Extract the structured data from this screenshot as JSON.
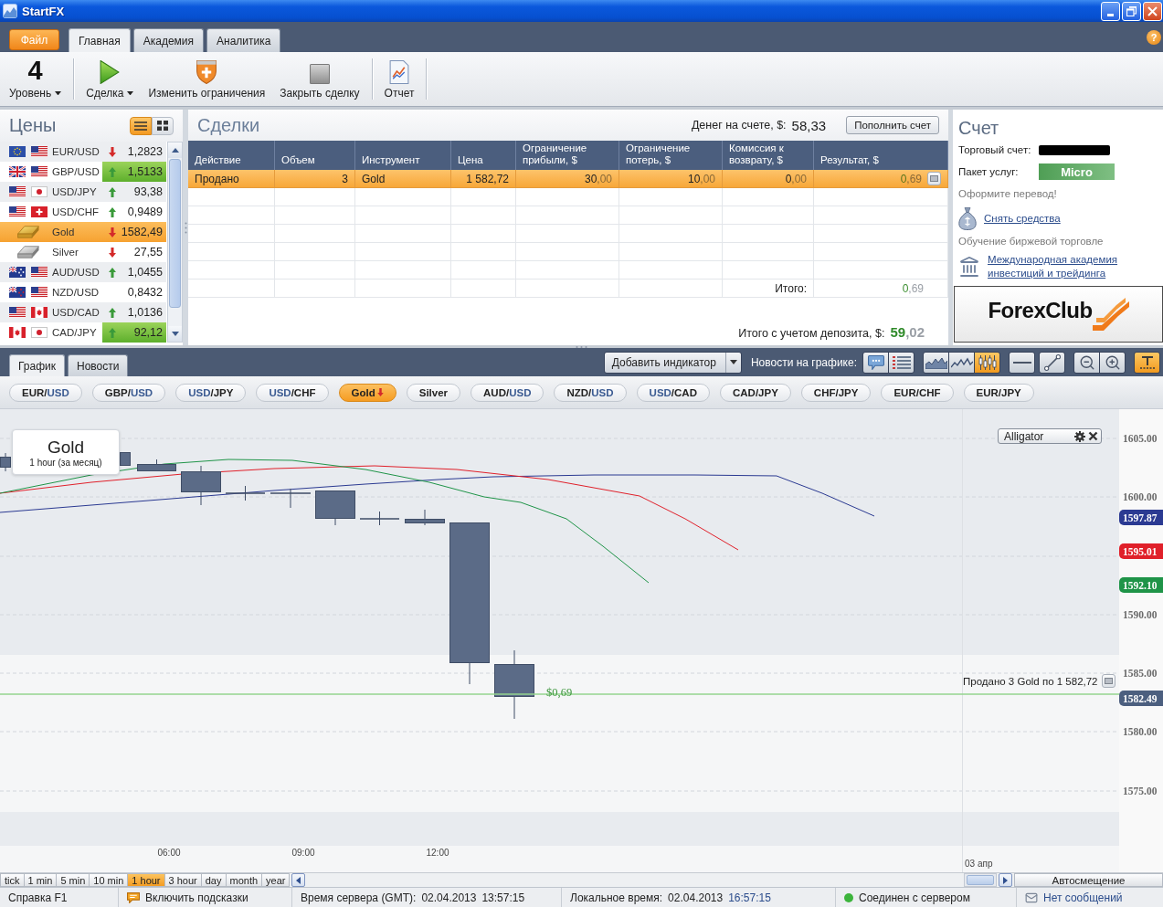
{
  "window": {
    "title": "StartFX"
  },
  "ribbon": {
    "file_button": "Файл",
    "tabs": [
      {
        "label": "Главная",
        "selected": true
      },
      {
        "label": "Академия",
        "selected": false
      },
      {
        "label": "Аналитика",
        "selected": false
      }
    ],
    "help_button": "?"
  },
  "toolbar": {
    "level": {
      "value": "4",
      "label": "Уровень",
      "dropdown": true
    },
    "buttons": [
      {
        "label": "Сделка",
        "dropdown": true
      },
      {
        "label": "Изменить ограничения",
        "dropdown": false
      },
      {
        "label": "Закрыть сделку",
        "dropdown": false
      },
      {
        "label": "Отчет",
        "dropdown": false
      }
    ]
  },
  "prices": {
    "title": "Цены",
    "views": [
      {
        "selected": true
      },
      {
        "selected": false
      }
    ],
    "rows": [
      {
        "name": "EUR/USD",
        "rising": false,
        "falling": true,
        "price": "1,2823",
        "flash": false,
        "selected": false
      },
      {
        "name": "GBP/USD",
        "rising": true,
        "falling": false,
        "price": "1,5133",
        "flash": true,
        "selected": false
      },
      {
        "name": "USD/JPY",
        "rising": true,
        "falling": false,
        "price": "93,38",
        "flash": false,
        "selected": false
      },
      {
        "name": "USD/CHF",
        "rising": true,
        "falling": false,
        "price": "0,9489",
        "flash": false,
        "selected": false
      },
      {
        "name": "Gold",
        "rising": false,
        "falling": true,
        "price": "1582,49",
        "flash": false,
        "selected": true
      },
      {
        "name": "Silver",
        "rising": false,
        "falling": true,
        "price": "27,55",
        "flash": false,
        "selected": false
      },
      {
        "name": "AUD/USD",
        "rising": true,
        "falling": false,
        "price": "1,0455",
        "flash": false,
        "selected": false
      },
      {
        "name": "NZD/USD",
        "rising": false,
        "falling": false,
        "price": "0,8432",
        "flash": false,
        "selected": false
      },
      {
        "name": "USD/CAD",
        "rising": true,
        "falling": false,
        "price": "1,0136",
        "flash": false,
        "selected": false
      },
      {
        "name": "CAD/JPY",
        "rising": true,
        "falling": false,
        "price": "92,12",
        "flash": true,
        "selected": false
      }
    ]
  },
  "deals": {
    "title": "Сделки",
    "balance_label": "Денег на счете, $:",
    "balance": "58,33",
    "deposit_button": "Пополнить счет",
    "columns": [
      "Действие",
      "Объем",
      "Инструмент",
      "Цена",
      "Ограничение прибыли, $",
      "Ограничение потерь, $",
      "Комиссия к возврату, $",
      "Результат, $"
    ],
    "rows": [
      {
        "selected": true,
        "cells": [
          {
            "text": "Продано"
          },
          {
            "text": "3"
          },
          {
            "text": "Gold"
          },
          {
            "text": "1 582,72"
          },
          {
            "text": "30",
            "faint": ",00"
          },
          {
            "text": "10",
            "faint": ",00"
          },
          {
            "text": "0",
            "faint": ",00"
          },
          {
            "text": "0",
            "faint": ",69"
          }
        ]
      }
    ],
    "total": {
      "label": "Итого:",
      "value": "0",
      "faint": ",69"
    },
    "deposit_total": {
      "label": "Итого с учетом депозита, $:",
      "value": "59",
      "faint": ",02"
    }
  },
  "account": {
    "title": "Счет",
    "trading_account_label": "Торговый счет:",
    "service_label": "Пакет услуг:",
    "service_badge": "Micro",
    "transfer_hint": "Оформите перевод!",
    "withdraw_link": "Снять средства",
    "learning_hint": "Обучение биржевой торговле",
    "academy_link": "Международная академия инвестиций и трейдинга",
    "logo": "ForexClub"
  },
  "chart_panel": {
    "tabs": [
      {
        "label": "График",
        "selected": true
      },
      {
        "label": "Новости",
        "selected": false
      }
    ],
    "indicator_button": "Добавить индикатор",
    "news_label": "Новости на графике:",
    "chart_types": [
      {
        "selected": false
      },
      {
        "selected": false
      },
      {
        "selected": true
      }
    ],
    "scale_toggle": {
      "on": true
    },
    "instruments": [
      {
        "parts": [
          {
            "text": "EUR/",
            "accent": false
          },
          {
            "text": "USD",
            "accent": true
          }
        ],
        "selected": false,
        "falling": false
      },
      {
        "parts": [
          {
            "text": "GBP/",
            "accent": false
          },
          {
            "text": "USD",
            "accent": true
          }
        ],
        "selected": false,
        "falling": false
      },
      {
        "parts": [
          {
            "text": "USD",
            "accent": true
          },
          {
            "text": "/JPY",
            "accent": false
          }
        ],
        "selected": false,
        "falling": false
      },
      {
        "parts": [
          {
            "text": "USD",
            "accent": true
          },
          {
            "text": "/CHF",
            "accent": false
          }
        ],
        "selected": false,
        "falling": false
      },
      {
        "parts": [
          {
            "text": "Gold",
            "accent": false
          }
        ],
        "selected": true,
        "falling": true
      },
      {
        "parts": [
          {
            "text": "Silver",
            "accent": false
          }
        ],
        "selected": false,
        "falling": false
      },
      {
        "parts": [
          {
            "text": "AUD/",
            "accent": false
          },
          {
            "text": "USD",
            "accent": true
          }
        ],
        "selected": false,
        "falling": false
      },
      {
        "parts": [
          {
            "text": "NZD/",
            "accent": false
          },
          {
            "text": "USD",
            "accent": true
          }
        ],
        "selected": false,
        "falling": false
      },
      {
        "parts": [
          {
            "text": "USD",
            "accent": true
          },
          {
            "text": "/CAD",
            "accent": false
          }
        ],
        "selected": false,
        "falling": false
      },
      {
        "parts": [
          {
            "text": "CAD/JPY",
            "accent": false
          }
        ],
        "selected": false,
        "falling": false
      },
      {
        "parts": [
          {
            "text": "CHF/JPY",
            "accent": false
          }
        ],
        "selected": false,
        "falling": false
      },
      {
        "parts": [
          {
            "text": "EUR/CHF",
            "accent": false
          }
        ],
        "selected": false,
        "falling": false
      },
      {
        "parts": [
          {
            "text": "EUR/JPY",
            "accent": false
          }
        ],
        "selected": false,
        "falling": false
      }
    ]
  },
  "chart": {
    "card_title": "Gold",
    "card_subtitle": "1 hour (за месяц)",
    "indicator": "Alligator",
    "profit_label": "$0,69",
    "order_label": "Продано 3 Gold по 1 582,72",
    "y_labels": [
      "1605.00",
      "1600.00",
      "1590.00",
      "1585.00",
      "1580.00",
      "1575.00"
    ],
    "price_badges": [
      {
        "text": "1597.87",
        "color": "#2b3a92"
      },
      {
        "text": "1595.01",
        "color": "#e0202a"
      },
      {
        "text": "1592.10",
        "color": "#1f9448"
      },
      {
        "text": "1582.49",
        "color": "#4c5f7f"
      }
    ],
    "x_labels": [
      "06:00",
      "09:00",
      "12:00"
    ],
    "date_label": "03 апр"
  },
  "timeframes": [
    {
      "label": "tick",
      "selected": false
    },
    {
      "label": "1 min",
      "selected": false
    },
    {
      "label": "5 min",
      "selected": false
    },
    {
      "label": "10 min",
      "selected": false
    },
    {
      "label": "1 hour",
      "selected": true
    },
    {
      "label": "3 hour",
      "selected": false
    },
    {
      "label": "day",
      "selected": false
    },
    {
      "label": "month",
      "selected": false
    },
    {
      "label": "year",
      "selected": false
    }
  ],
  "autoscroll_button": "Автосмещение",
  "status_bar": {
    "help": "Справка F1",
    "hints": "Включить подсказки",
    "server_label": "Время сервера (GMT):",
    "server_date": "02.04.2013",
    "server_time": "13:57:15",
    "local_label": "Локальное время:",
    "local_date": "02.04.2013",
    "local_time": "16:57:15",
    "connection": "Соединен с сервером",
    "connected": true,
    "messages": "Нет сообщений"
  }
}
